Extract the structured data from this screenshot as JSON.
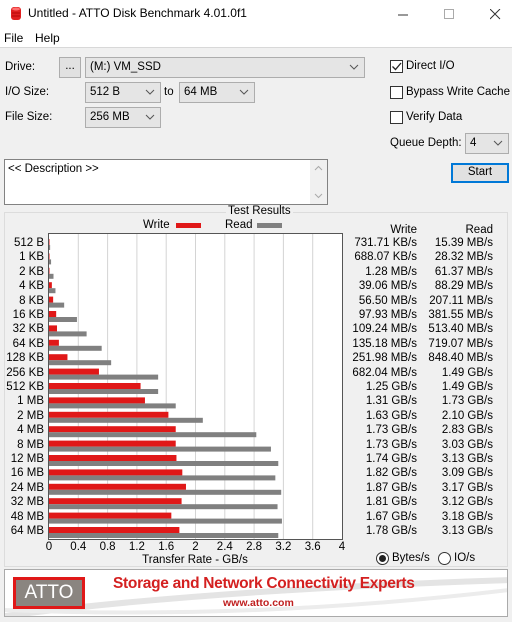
{
  "window": {
    "title": "Untitled - ATTO Disk Benchmark 4.01.0f1",
    "controls": {
      "minimize": "—",
      "maximize": "☐",
      "close": "✕"
    }
  },
  "menu": {
    "items": [
      {
        "label": "File"
      },
      {
        "label": "Help"
      }
    ]
  },
  "settings": {
    "drive_label": "Drive:",
    "browse_label": "...",
    "drive_value": "(M:) VM_SSD",
    "io_size_label": "I/O Size:",
    "io_from": "512 B",
    "io_to_label": "to",
    "io_to": "64 MB",
    "file_size_label": "File Size:",
    "file_size": "256 MB",
    "direct_io": {
      "label": "Direct I/O",
      "checked": true
    },
    "bypass_write_cache": {
      "label": "Bypass Write Cache",
      "checked": false
    },
    "verify_data": {
      "label": "Verify Data",
      "checked": false
    },
    "queue_depth_label": "Queue Depth:",
    "queue_depth": "4",
    "start_label": "Start"
  },
  "description": {
    "text": "<< Description >>"
  },
  "results": {
    "group_title": "Test Results",
    "legend": {
      "write": "Write",
      "read": "Read"
    },
    "column_headers": {
      "write": "Write",
      "read": "Read"
    },
    "units": {
      "bytes": "Bytes/s",
      "io": "IO/s",
      "selected": "bytes"
    },
    "colors": {
      "write": "#e01818",
      "read": "#808080"
    },
    "rows": [
      {
        "size": "512 B",
        "write": "731.71 KB/s",
        "read": "15.39 MB/s"
      },
      {
        "size": "1 KB",
        "write": "688.07 KB/s",
        "read": "28.32 MB/s"
      },
      {
        "size": "2 KB",
        "write": "1.28 MB/s",
        "read": "61.37 MB/s"
      },
      {
        "size": "4 KB",
        "write": "39.06 MB/s",
        "read": "88.29 MB/s"
      },
      {
        "size": "8 KB",
        "write": "56.50 MB/s",
        "read": "207.11 MB/s"
      },
      {
        "size": "16 KB",
        "write": "97.93 MB/s",
        "read": "381.55 MB/s"
      },
      {
        "size": "32 KB",
        "write": "109.24 MB/s",
        "read": "513.40 MB/s"
      },
      {
        "size": "64 KB",
        "write": "135.18 MB/s",
        "read": "719.07 MB/s"
      },
      {
        "size": "128 KB",
        "write": "251.98 MB/s",
        "read": "848.40 MB/s"
      },
      {
        "size": "256 KB",
        "write": "682.04 MB/s",
        "read": "1.49 GB/s"
      },
      {
        "size": "512 KB",
        "write": "1.25 GB/s",
        "read": "1.49 GB/s"
      },
      {
        "size": "1 MB",
        "write": "1.31 GB/s",
        "read": "1.73 GB/s"
      },
      {
        "size": "2 MB",
        "write": "1.63 GB/s",
        "read": "2.10 GB/s"
      },
      {
        "size": "4 MB",
        "write": "1.73 GB/s",
        "read": "2.83 GB/s"
      },
      {
        "size": "8 MB",
        "write": "1.73 GB/s",
        "read": "3.03 GB/s"
      },
      {
        "size": "12 MB",
        "write": "1.74 GB/s",
        "read": "3.13 GB/s"
      },
      {
        "size": "16 MB",
        "write": "1.82 GB/s",
        "read": "3.09 GB/s"
      },
      {
        "size": "24 MB",
        "write": "1.87 GB/s",
        "read": "3.17 GB/s"
      },
      {
        "size": "32 MB",
        "write": "1.81 GB/s",
        "read": "3.12 GB/s"
      },
      {
        "size": "48 MB",
        "write": "1.67 GB/s",
        "read": "3.18 GB/s"
      },
      {
        "size": "64 MB",
        "write": "1.78 GB/s",
        "read": "3.13 GB/s"
      }
    ]
  },
  "chart_data": {
    "type": "bar",
    "orientation": "horizontal",
    "xlabel": "Transfer Rate - GB/s",
    "xlim": [
      0,
      4
    ],
    "xticks": [
      "0",
      "0.4",
      "0.8",
      "1.2",
      "1.6",
      "2",
      "2.4",
      "2.8",
      "3.2",
      "3.6",
      "4"
    ],
    "grid": true,
    "legend": "top",
    "categories": [
      "512 B",
      "1 KB",
      "2 KB",
      "4 KB",
      "8 KB",
      "16 KB",
      "32 KB",
      "64 KB",
      "128 KB",
      "256 KB",
      "512 KB",
      "1 MB",
      "2 MB",
      "4 MB",
      "8 MB",
      "12 MB",
      "16 MB",
      "24 MB",
      "32 MB",
      "48 MB",
      "64 MB"
    ],
    "series": [
      {
        "name": "Write",
        "values": [
          0.00073,
          0.00069,
          0.00128,
          0.03906,
          0.0565,
          0.09793,
          0.10924,
          0.13518,
          0.25198,
          0.68204,
          1.25,
          1.31,
          1.63,
          1.73,
          1.73,
          1.74,
          1.82,
          1.87,
          1.81,
          1.67,
          1.78
        ]
      },
      {
        "name": "Read",
        "values": [
          0.01539,
          0.02832,
          0.06137,
          0.08829,
          0.20711,
          0.38155,
          0.5134,
          0.71907,
          0.8484,
          1.49,
          1.49,
          1.73,
          2.1,
          2.83,
          3.03,
          3.13,
          3.09,
          3.17,
          3.12,
          3.18,
          3.13
        ]
      }
    ]
  },
  "banner": {
    "logo": "ATTO",
    "tagline": "Storage and Network Connectivity Experts",
    "website": "www.atto.com"
  }
}
